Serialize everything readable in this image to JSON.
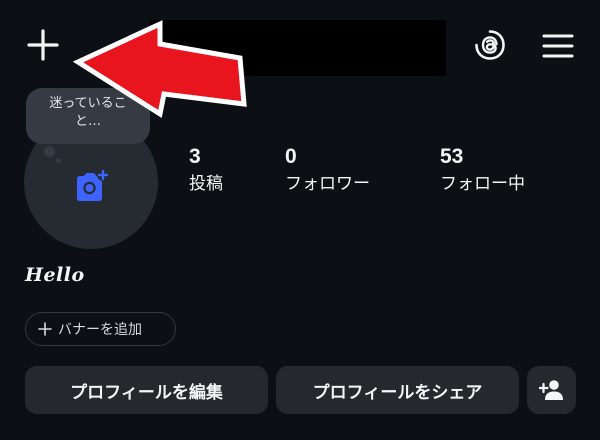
{
  "topbar": {
    "new_post_icon": "plus-icon",
    "threads_icon": "threads-icon",
    "menu_icon": "hamburger-menu-icon"
  },
  "annotation": {
    "arrow_color": "#e8151f",
    "arrow_icon": "red-arrow-pointing-to-plus"
  },
  "profile": {
    "avatar_icon": "add-photo-camera-icon",
    "note": {
      "line1": "迷っているこ",
      "line2": "と…"
    },
    "display_name": "Hello",
    "add_banner_label": "バナーを追加"
  },
  "stats": [
    {
      "value": "3",
      "label": "投稿"
    },
    {
      "value": "0",
      "label": "フォロワー"
    },
    {
      "value": "53",
      "label": "フォロー中"
    }
  ],
  "actions": {
    "edit_label": "プロフィールを編集",
    "share_label": "プロフィールをシェア",
    "add_person_icon": "add-person-icon"
  },
  "colors": {
    "background": "#0c1014",
    "button_bg": "#25292e",
    "avatar_bg": "#262a31",
    "camera_blue": "#3e64ff",
    "text": "#f5f5f5"
  }
}
